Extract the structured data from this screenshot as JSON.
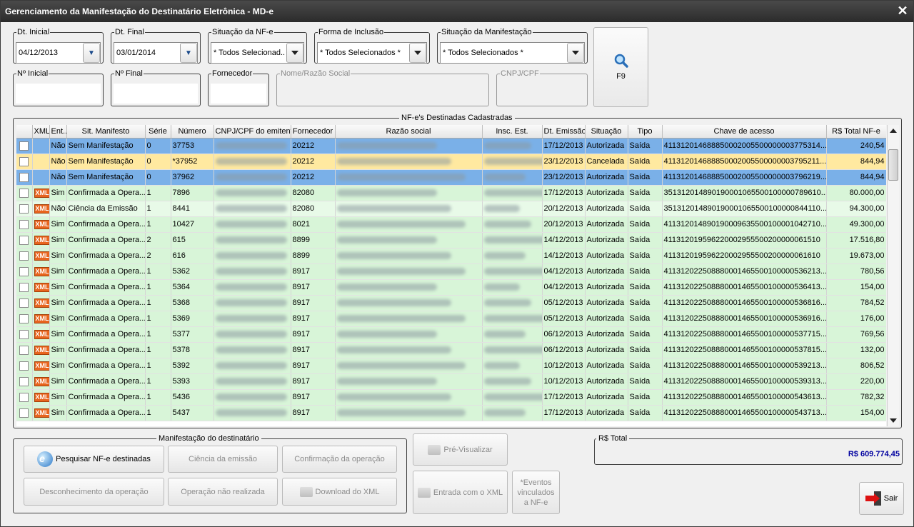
{
  "window": {
    "title": "Gerenciamento da Manifestação do Destinatário Eletrônica - MD-e",
    "close_glyph": "✕"
  },
  "filters": {
    "dt_inicial": {
      "label": "Dt. Inicial",
      "value": "04/12/2013"
    },
    "dt_final": {
      "label": "Dt. Final",
      "value": "03/01/2014"
    },
    "situacao_nfe": {
      "label": "Situação da NF-e",
      "value": "* Todos Selecionad..."
    },
    "forma_inclusao": {
      "label": "Forma de Inclusão",
      "value": "* Todos Selecionados *"
    },
    "situacao_manifestacao": {
      "label": "Situação da Manifestação",
      "value": "* Todos Selecionados *"
    },
    "n_inicial": {
      "label": "Nº Inicial",
      "value": ""
    },
    "n_final": {
      "label": "Nº Final",
      "value": ""
    },
    "fornecedor": {
      "label": "Fornecedor",
      "value": ""
    },
    "razao_social": {
      "label": "Nome/Razão Social",
      "value": ""
    },
    "cnpj_cpf": {
      "label": "CNPJ/CPF",
      "value": ""
    },
    "search_button": {
      "label": "F9",
      "icon": "magnifier-icon"
    }
  },
  "grid": {
    "title": "NF-e's Destinadas Cadastradas",
    "columns": [
      "",
      "XML",
      "Ent...",
      "Sit. Manifesto",
      "Série",
      "Número",
      "CNPJ/CPF do emitente",
      "Fornecedor",
      "Razão social",
      "Insc. Est.",
      "Dt. Emissão",
      "Situação",
      "Tipo",
      "Chave de acesso",
      "R$ Total NF-e"
    ],
    "rows": [
      {
        "style": "r-blue",
        "xml": false,
        "ent": "Não",
        "sit": "Sem Manifestação",
        "serie": "0",
        "numero": "37753",
        "fornecedor": "20212",
        "dt": "17/12/2013",
        "situacao": "Autorizada",
        "tipo": "Saída",
        "chave": "41131201468885000200550000000377531​4...",
        "total": "240,54"
      },
      {
        "style": "r-yellow",
        "xml": false,
        "ent": "Não",
        "sit": "Sem Manifestação",
        "serie": "0",
        "numero": "*37952",
        "fornecedor": "20212",
        "dt": "23/12/2013",
        "situacao": "Cancelada",
        "tipo": "Saída",
        "chave": "41131201468885000200550000000379521​1...",
        "total": "844,94"
      },
      {
        "style": "r-blue",
        "xml": false,
        "ent": "Não",
        "sit": "Sem Manifestação",
        "serie": "0",
        "numero": "37962",
        "fornecedor": "20212",
        "dt": "23/12/2013",
        "situacao": "Autorizada",
        "tipo": "Saída",
        "chave": "41131201468885000200550000000379621​9...",
        "total": "844,94"
      },
      {
        "style": "r-green",
        "xml": true,
        "ent": "Sim",
        "sit": "Confirmada a Opera...",
        "serie": "1",
        "numero": "7896",
        "fornecedor": "82080",
        "dt": "17/12/2013",
        "situacao": "Autorizada",
        "tipo": "Saída",
        "chave": "3513120148901900010655001000007896​10...",
        "total": "80.000,00"
      },
      {
        "style": "r-green2",
        "xml": true,
        "ent": "Não",
        "sit": "Ciência da Emissão",
        "serie": "1",
        "numero": "8441",
        "fornecedor": "82080",
        "dt": "20/12/2013",
        "situacao": "Autorizada",
        "tipo": "Saída",
        "chave": "3513120148901900010655001000008441​10...",
        "total": "94.300,00"
      },
      {
        "style": "r-green",
        "xml": true,
        "ent": "Sim",
        "sit": "Confirmada a Opera...",
        "serie": "1",
        "numero": "10427",
        "fornecedor": "8021",
        "dt": "20/12/2013",
        "situacao": "Autorizada",
        "tipo": "Saída",
        "chave": "4113120148901900096355001000010427​10...",
        "total": "49.300,00"
      },
      {
        "style": "r-green",
        "xml": true,
        "ent": "Sim",
        "sit": "Confirmada a Opera...",
        "serie": "2",
        "numero": "615",
        "fornecedor": "8899",
        "dt": "14/12/2013",
        "situacao": "Autorizada",
        "tipo": "Saída",
        "chave": "41131201959622000295550020000006151​0",
        "total": "17.516,80"
      },
      {
        "style": "r-green",
        "xml": true,
        "ent": "Sim",
        "sit": "Confirmada a Opera...",
        "serie": "2",
        "numero": "616",
        "fornecedor": "8899",
        "dt": "14/12/2013",
        "situacao": "Autorizada",
        "tipo": "Saída",
        "chave": "41131201959622000295550020000006161​0",
        "total": "19.673,00"
      },
      {
        "style": "r-green",
        "xml": true,
        "ent": "Sim",
        "sit": "Confirmada a Opera...",
        "serie": "1",
        "numero": "5362",
        "fornecedor": "8917",
        "dt": "04/12/2013",
        "situacao": "Autorizada",
        "tipo": "Saída",
        "chave": "41131202250888000146550010000053621​3...",
        "total": "780,56"
      },
      {
        "style": "r-green",
        "xml": true,
        "ent": "Sim",
        "sit": "Confirmada a Opera...",
        "serie": "1",
        "numero": "5364",
        "fornecedor": "8917",
        "dt": "04/12/2013",
        "situacao": "Autorizada",
        "tipo": "Saída",
        "chave": "41131202250888000146550010000053641​3...",
        "total": "154,00"
      },
      {
        "style": "r-green",
        "xml": true,
        "ent": "Sim",
        "sit": "Confirmada a Opera...",
        "serie": "1",
        "numero": "5368",
        "fornecedor": "8917",
        "dt": "05/12/2013",
        "situacao": "Autorizada",
        "tipo": "Saída",
        "chave": "41131202250888000146550010000053681​6...",
        "total": "784,52"
      },
      {
        "style": "r-green",
        "xml": true,
        "ent": "Sim",
        "sit": "Confirmada a Opera...",
        "serie": "1",
        "numero": "5369",
        "fornecedor": "8917",
        "dt": "05/12/2013",
        "situacao": "Autorizada",
        "tipo": "Saída",
        "chave": "41131202250888000146550010000053691​6...",
        "total": "176,00"
      },
      {
        "style": "r-green",
        "xml": true,
        "ent": "Sim",
        "sit": "Confirmada a Opera...",
        "serie": "1",
        "numero": "5377",
        "fornecedor": "8917",
        "dt": "06/12/2013",
        "situacao": "Autorizada",
        "tipo": "Saída",
        "chave": "41131202250888000146550010000053771​5...",
        "total": "769,56"
      },
      {
        "style": "r-green",
        "xml": true,
        "ent": "Sim",
        "sit": "Confirmada a Opera...",
        "serie": "1",
        "numero": "5378",
        "fornecedor": "8917",
        "dt": "06/12/2013",
        "situacao": "Autorizada",
        "tipo": "Saída",
        "chave": "41131202250888000146550010000053781​5...",
        "total": "132,00"
      },
      {
        "style": "r-green",
        "xml": true,
        "ent": "Sim",
        "sit": "Confirmada a Opera...",
        "serie": "1",
        "numero": "5392",
        "fornecedor": "8917",
        "dt": "10/12/2013",
        "situacao": "Autorizada",
        "tipo": "Saída",
        "chave": "41131202250888000146550010000053921​3...",
        "total": "806,52"
      },
      {
        "style": "r-green",
        "xml": true,
        "ent": "Sim",
        "sit": "Confirmada a Opera...",
        "serie": "1",
        "numero": "5393",
        "fornecedor": "8917",
        "dt": "10/12/2013",
        "situacao": "Autorizada",
        "tipo": "Saída",
        "chave": "41131202250888000146550010000053931​3...",
        "total": "220,00"
      },
      {
        "style": "r-green",
        "xml": true,
        "ent": "Sim",
        "sit": "Confirmada a Opera...",
        "serie": "1",
        "numero": "5436",
        "fornecedor": "8917",
        "dt": "17/12/2013",
        "situacao": "Autorizada",
        "tipo": "Saída",
        "chave": "41131202250888000146550010000054361​3...",
        "total": "782,32"
      },
      {
        "style": "r-green",
        "xml": true,
        "ent": "Sim",
        "sit": "Confirmada a Opera...",
        "serie": "1",
        "numero": "5437",
        "fornecedor": "8917",
        "dt": "17/12/2013",
        "situacao": "Autorizada",
        "tipo": "Saída",
        "chave": "41131202250888000146550010000054371​3...",
        "total": "154,00"
      }
    ]
  },
  "manifestacao": {
    "title": "Manifestação do destinatário",
    "pesquisar": "Pesquisar NF-e destinadas",
    "ciencia": "Ciência da emissão",
    "confirmacao": "Confirmação da operação",
    "desconhecimento": "Desconhecimento da operação",
    "nao_realizada": "Operação não realizada",
    "download": "Download do XML"
  },
  "actions": {
    "pre_visualizar": "Pré-Visualizar",
    "entrada_xml": "Entrada com o XML",
    "eventos": "*Eventos vinculados a NF-e",
    "sair": "Sair"
  },
  "total": {
    "label": "R$ Total",
    "value": "R$ 609.774,45"
  },
  "colors": {
    "selected_row": "#7ab0e8",
    "cancelled_row": "#ffe9a0",
    "confirmed_row": "#d8f5d8",
    "total_value": "#0000a0",
    "xml_badge": "#e8641e"
  }
}
